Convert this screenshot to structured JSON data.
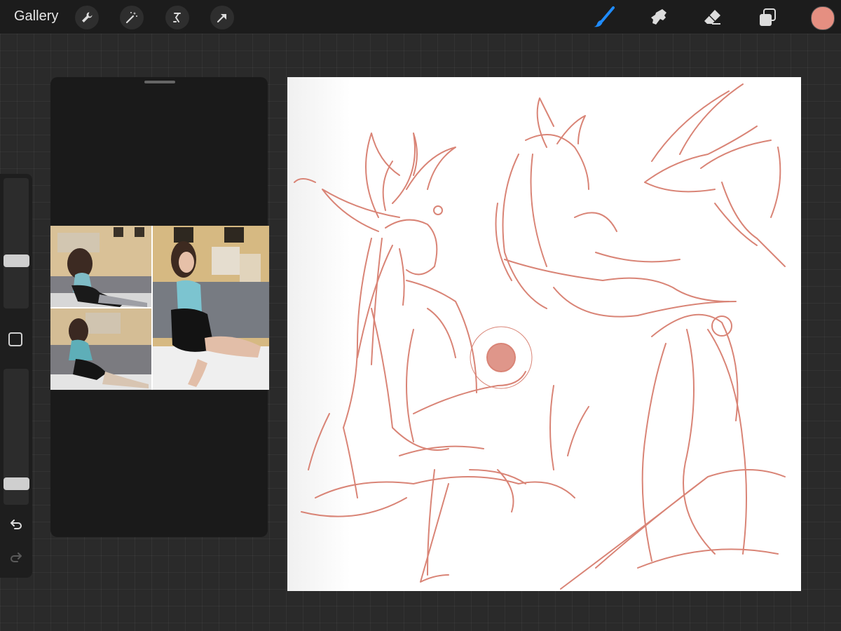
{
  "topbar": {
    "gallery_label": "Gallery",
    "left_tools": [
      {
        "name": "wrench-icon",
        "action": "actions"
      },
      {
        "name": "magic-wand-icon",
        "action": "adjustments"
      },
      {
        "name": "selection-icon",
        "action": "selection"
      },
      {
        "name": "transform-arrow-icon",
        "action": "transform"
      }
    ],
    "right_tools": [
      {
        "name": "brush-icon",
        "active": true
      },
      {
        "name": "smudge-icon",
        "active": false
      },
      {
        "name": "eraser-icon",
        "active": false
      },
      {
        "name": "layers-icon",
        "active": false
      }
    ],
    "current_color": "#e58f81"
  },
  "sidebar": {
    "brush_size_level": 0.35,
    "opacity_level": 0.12
  },
  "colors": {
    "sketch_stroke": "#d98476",
    "active_tool": "#1f8cff",
    "background": "#2a2a2a"
  }
}
